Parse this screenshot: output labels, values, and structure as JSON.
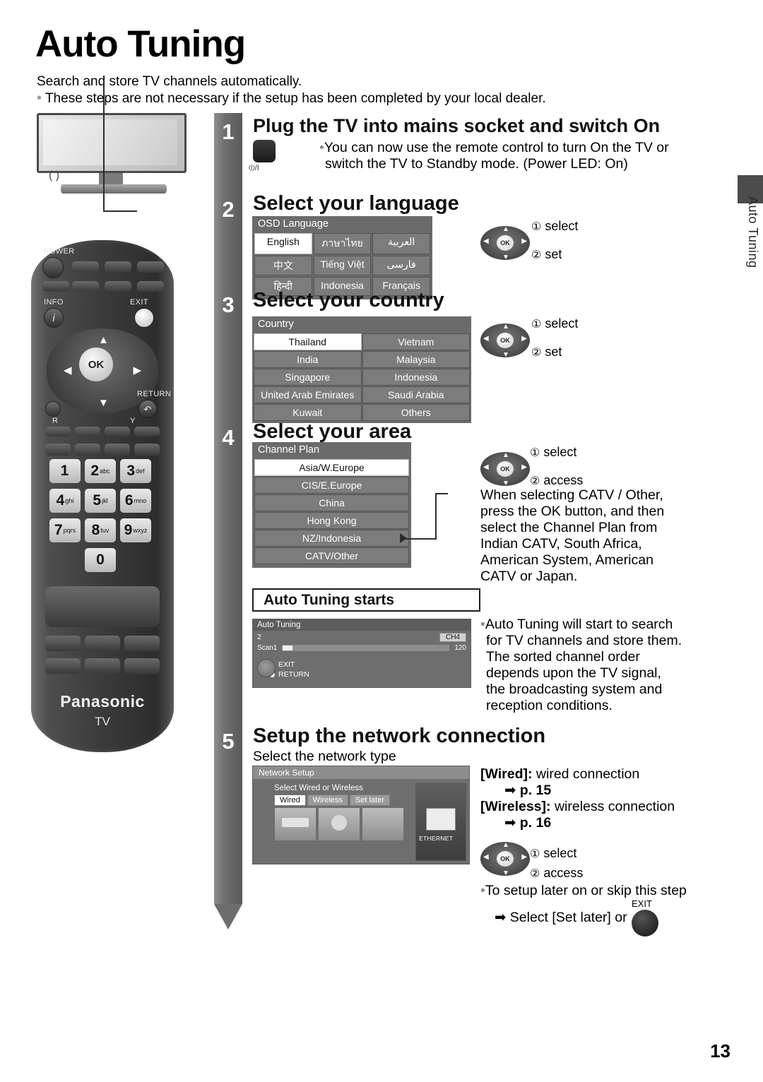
{
  "header": {
    "title": "Auto Tuning",
    "subtitle1": "Search and store TV channels automatically.",
    "subtitle2": "These steps are not necessary if the setup has been completed by your local dealer.",
    "bullet": "•"
  },
  "side_tab_label": "Auto Tuning",
  "page_number": "13",
  "steps": [
    {
      "num": "1",
      "title": "Plug the TV into mains socket and switch On"
    },
    {
      "num": "2",
      "title": "Select your language"
    },
    {
      "num": "3",
      "title": "Select your country"
    },
    {
      "num": "4",
      "title": "Select your area"
    },
    {
      "num": "5",
      "title": "Setup the network connection"
    }
  ],
  "step1": {
    "bullet": "•",
    "line1": "You can now use the remote control to turn On the TV or",
    "line2": "switch the TV to Standby mode. (Power LED: On)",
    "power_label": "⏼/I"
  },
  "osd_language": {
    "title": "OSD Language",
    "cells": [
      {
        "label": "English",
        "selected": true
      },
      {
        "label": "ภาษาไทย",
        "selected": false
      },
      {
        "label": "العربية",
        "selected": false
      },
      {
        "label": "中文",
        "selected": false
      },
      {
        "label": "Tiếng Việt",
        "selected": false
      },
      {
        "label": "فارسی",
        "selected": false
      },
      {
        "label": "हिन्दी",
        "selected": false
      },
      {
        "label": "Indonesia",
        "selected": false
      },
      {
        "label": "Français",
        "selected": false
      }
    ]
  },
  "osd_country": {
    "title": "Country",
    "cells": [
      {
        "label": "Thailand",
        "selected": true
      },
      {
        "label": "Vietnam",
        "selected": false
      },
      {
        "label": "India",
        "selected": false
      },
      {
        "label": "Malaysia",
        "selected": false
      },
      {
        "label": "Singapore",
        "selected": false
      },
      {
        "label": "Indonesia",
        "selected": false
      },
      {
        "label": "United Arab Emirates",
        "selected": false
      },
      {
        "label": "Saudi Arabia",
        "selected": false
      },
      {
        "label": "Kuwait",
        "selected": false
      },
      {
        "label": "Others",
        "selected": false
      }
    ]
  },
  "osd_channel_plan": {
    "title": "Channel Plan",
    "cells": [
      {
        "label": "Asia/W.Europe",
        "selected": true
      },
      {
        "label": "CIS/E.Europe",
        "selected": false
      },
      {
        "label": "China",
        "selected": false
      },
      {
        "label": "Hong Kong",
        "selected": false
      },
      {
        "label": "NZ/Indonesia",
        "selected": false
      },
      {
        "label": "CATV/Other",
        "selected": false
      }
    ]
  },
  "catv_note": [
    "When selecting CATV / Other,",
    "press the OK button, and then",
    "select the Channel Plan from",
    "Indian CATV, South Africa,",
    "American System, American",
    "CATV or Japan."
  ],
  "auto_tuning_starts": {
    "heading": "Auto Tuning starts",
    "panel": {
      "title": "Auto Tuning",
      "row_num": "2",
      "scan_label": "Scan",
      "progress_left": "1",
      "progress_right": "120",
      "channel": "CH4",
      "key_exit": "EXIT",
      "key_return": "RETURN"
    },
    "note_bullet": "•",
    "note": [
      "Auto Tuning will start to search",
      "for TV channels and store them.",
      "The sorted channel order",
      "depends upon the TV signal,",
      "the broadcasting system and",
      "reception conditions."
    ]
  },
  "step5": {
    "select_type": "Select the network type",
    "panel": {
      "title": "Network Setup",
      "subtitle": "Select Wired or Wireless",
      "tabs": [
        {
          "label": "Wired",
          "selected": true
        },
        {
          "label": "Wireless",
          "selected": false
        },
        {
          "label": "Set later",
          "selected": false
        }
      ],
      "ethernet_label": "ETHERNET"
    },
    "wired_label": "[Wired]:",
    "wired_text": "wired connection",
    "wired_page": "p. 15",
    "wireless_label": "[Wireless]:",
    "wireless_text": "wireless connection",
    "wireless_page": "p. 16",
    "skip_bullet": "•",
    "skip_text": "To setup later on or skip this step",
    "skip_select": "Select [Set later] or",
    "exit_label": "EXIT",
    "arrow": "➡"
  },
  "nav": {
    "ok": "OK",
    "select": "select",
    "set": "set",
    "access": "access",
    "one": "①",
    "two": "②",
    "up": "▲",
    "down": "▼",
    "left": "◀",
    "right": "▶"
  },
  "remote": {
    "power_label": "POWER",
    "info_label": "INFO",
    "exit_label": "EXIT",
    "return_label": "RETURN",
    "ok_label": "OK",
    "r_label": "R",
    "y_label": "Y",
    "brand": "Panasonic",
    "brand_sub": "TV",
    "keys": [
      {
        "num": "1",
        "sub": ""
      },
      {
        "num": "2",
        "sub": "abc"
      },
      {
        "num": "3",
        "sub": "def"
      },
      {
        "num": "4",
        "sub": "ghi"
      },
      {
        "num": "5",
        "sub": "jkl"
      },
      {
        "num": "6",
        "sub": "mno"
      },
      {
        "num": "7",
        "sub": "pqrs"
      },
      {
        "num": "8",
        "sub": "tuv"
      },
      {
        "num": "9",
        "sub": "wxyz"
      },
      {
        "num": "0",
        "sub": ""
      }
    ]
  }
}
